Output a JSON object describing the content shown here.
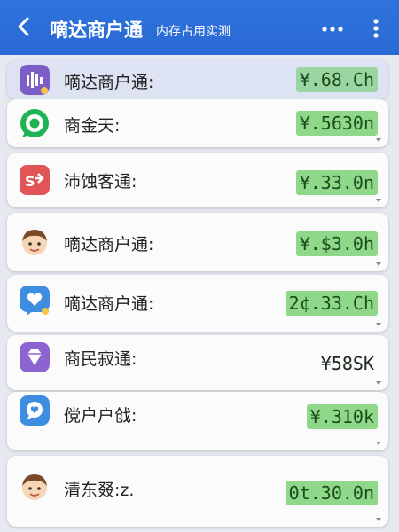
{
  "header": {
    "title": "嘀达商户通",
    "subtitle": "内存占用实测",
    "colors": {
      "bar": "#2a6ad6",
      "text": "#ffffff"
    }
  },
  "items": [
    {
      "name": "嘀达商户通:",
      "amount": "¥.68.Ch",
      "icon": "audio-waves-icon"
    },
    {
      "name": "商金天:",
      "amount": "¥.5630n",
      "icon": "chat-ring-icon"
    },
    {
      "name": "沛蚀客通:",
      "amount": "¥.33.0n",
      "icon": "transfer-icon"
    },
    {
      "name": "嘀达商户通:",
      "amount": "¥.$3.0h",
      "icon": "avatar-icon"
    },
    {
      "name": "嘀达商户通:",
      "amount": "2¢.33.Ch",
      "icon": "heart-bubble-icon"
    },
    {
      "name": "商民寂通:",
      "amount": "¥58SK",
      "icon": "gem-icon"
    },
    {
      "name": "傥户户戗:",
      "amount": "¥.310k",
      "icon": "chat-bubble-icon"
    },
    {
      "name": "清东叕:z.",
      "amount": "0t.30.0n",
      "icon": "avatar-icon"
    }
  ],
  "amount_highlight_color": "#8fd88a"
}
